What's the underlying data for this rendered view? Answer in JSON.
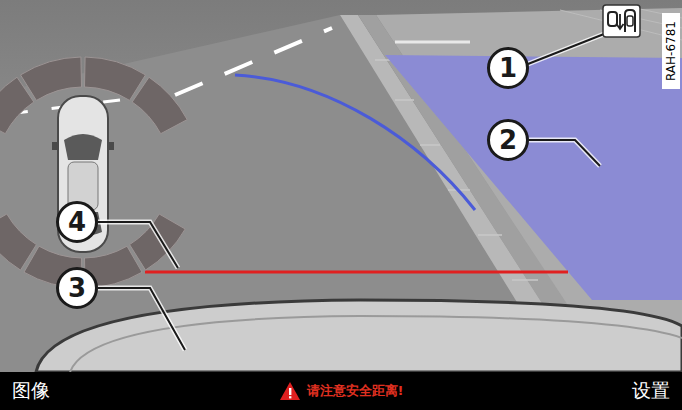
{
  "image_code": "RAH-6781",
  "callouts": [
    {
      "label": "1"
    },
    {
      "label": "2"
    },
    {
      "label": "3"
    },
    {
      "label": "4"
    }
  ],
  "bottom_bar": {
    "left_button": "图像",
    "warning": "请注意安全距离!",
    "right_button": "设置"
  }
}
